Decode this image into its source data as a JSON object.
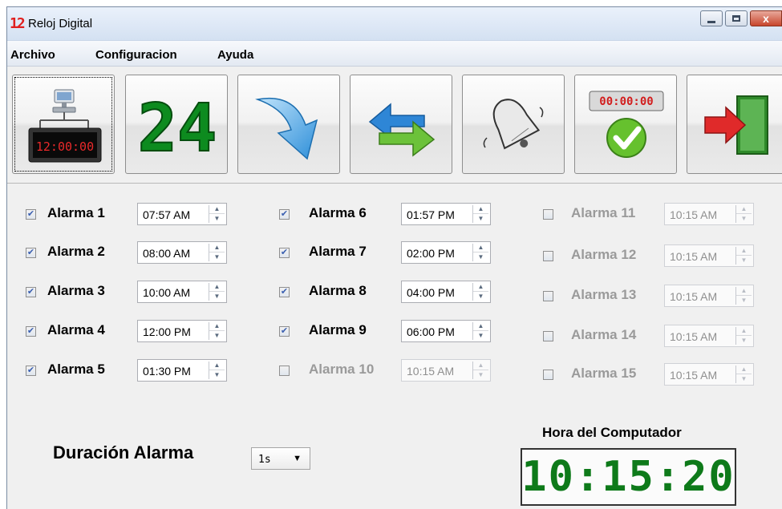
{
  "window": {
    "title": "Reloj Digital",
    "icon_glyph": "12",
    "minimize_icon": "minimize-icon",
    "maximize_icon": "maximize-icon",
    "close_label": "x"
  },
  "menu": [
    "Archivo",
    "Configuracion",
    "Ayuda"
  ],
  "toolbar": {
    "buttons": [
      {
        "icon": "computer-clock-icon",
        "clock_text": "12:00:00"
      },
      {
        "icon": "24-hour-icon",
        "text": "24"
      },
      {
        "icon": "arrow-down-right-icon"
      },
      {
        "icon": "refresh-arrows-icon"
      },
      {
        "icon": "bell-icon"
      },
      {
        "icon": "stopwatch-check-icon",
        "timer_text": "00:00:00"
      },
      {
        "icon": "exit-door-icon"
      }
    ]
  },
  "alarms": [
    {
      "label": "Alarma 1",
      "time": "07:57 AM",
      "checked": true,
      "enabled": true
    },
    {
      "label": "Alarma 2",
      "time": "08:00 AM",
      "checked": true,
      "enabled": true
    },
    {
      "label": "Alarma 3",
      "time": "10:00 AM",
      "checked": true,
      "enabled": true
    },
    {
      "label": "Alarma 4",
      "time": "12:00 PM",
      "checked": true,
      "enabled": true
    },
    {
      "label": "Alarma 5",
      "time": "01:30 PM",
      "checked": true,
      "enabled": true
    },
    {
      "label": "Alarma 6",
      "time": "01:57 PM",
      "checked": true,
      "enabled": true
    },
    {
      "label": "Alarma 7",
      "time": "02:00 PM",
      "checked": true,
      "enabled": true
    },
    {
      "label": "Alarma 8",
      "time": "04:00 PM",
      "checked": true,
      "enabled": true
    },
    {
      "label": "Alarma 9",
      "time": "06:00 PM",
      "checked": true,
      "enabled": true
    },
    {
      "label": "Alarma 10",
      "time": "10:15 AM",
      "checked": false,
      "enabled": false
    },
    {
      "label": "Alarma 11",
      "time": "10:15 AM",
      "checked": false,
      "enabled": false
    },
    {
      "label": "Alarma 12",
      "time": "10:15 AM",
      "checked": false,
      "enabled": false
    },
    {
      "label": "Alarma 13",
      "time": "10:15 AM",
      "checked": false,
      "enabled": false
    },
    {
      "label": "Alarma 14",
      "time": "10:15 AM",
      "checked": false,
      "enabled": false
    },
    {
      "label": "Alarma 15",
      "time": "10:15 AM",
      "checked": false,
      "enabled": false
    }
  ],
  "duracion": {
    "label": "Duración Alarma",
    "selected": "1s"
  },
  "computer_clock": {
    "label": "Hora del Computador",
    "time": "10:15:20"
  },
  "colors": {
    "clock_green": "#0e7a1a",
    "red_digit": "#e0201f",
    "check_blue": "#3a5fb0"
  }
}
